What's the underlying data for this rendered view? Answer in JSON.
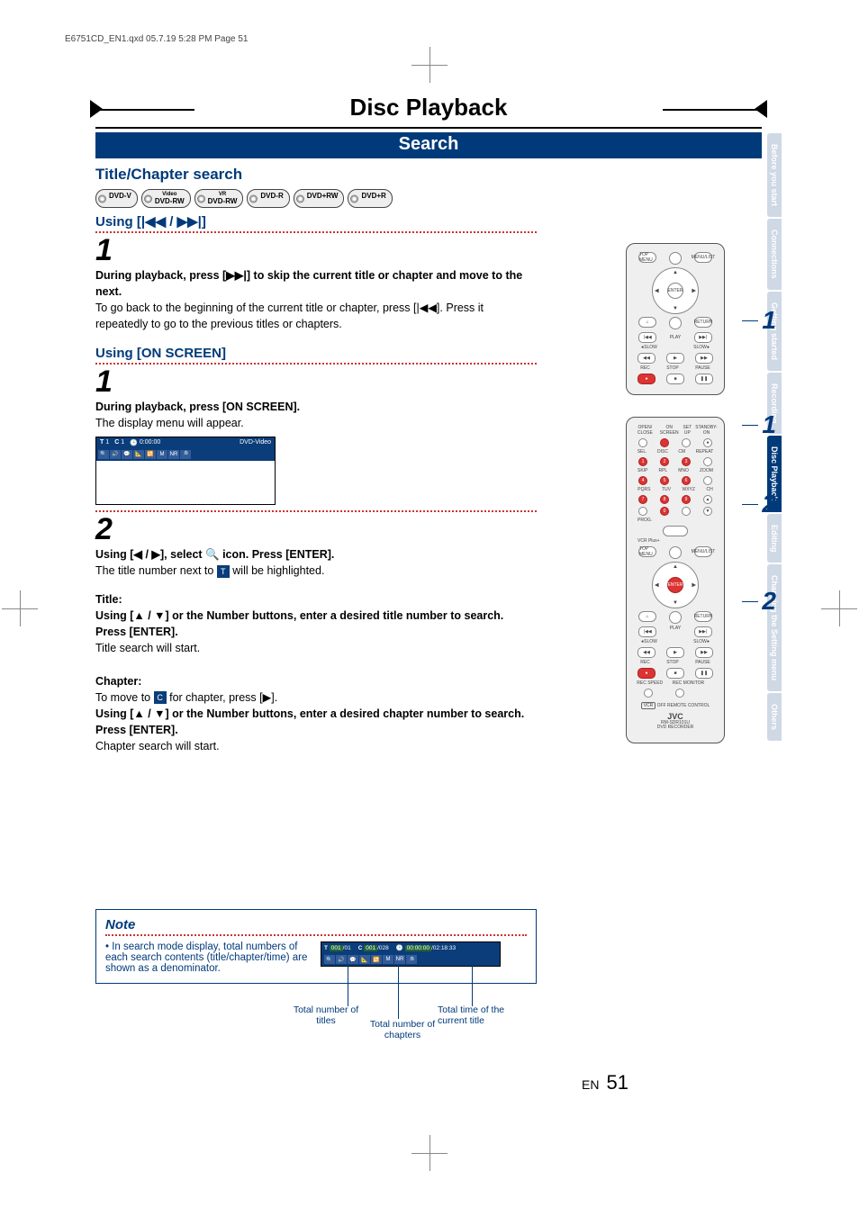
{
  "print_meta": "E6751CD_EN1.qxd  05.7.19  5:28 PM  Page 51",
  "page_title": "Disc Playback",
  "section_title": "Search",
  "h_title_chapter": "Title/Chapter search",
  "disc_badges": [
    {
      "label": "DVD-V",
      "sup": ""
    },
    {
      "label": "DVD-RW",
      "sup": "Video"
    },
    {
      "label": "DVD-RW",
      "sup": "VR"
    },
    {
      "label": "DVD-R",
      "sup": ""
    },
    {
      "label": "DVD+RW",
      "sup": ""
    },
    {
      "label": "DVD+R",
      "sup": ""
    }
  ],
  "using_skip": "Using [|◀◀ / ▶▶|]",
  "step1_a": "1",
  "skip_bold": "During playback, press [▶▶|] to skip the current title or chapter and move to the next.",
  "skip_body": "To go back to the beginning of the current title or chapter, press [|◀◀]. Press it repeatedly to go to the previous titles or chapters.",
  "using_onscreen": "Using [ON SCREEN]",
  "step1_b": "1",
  "on_bold": "During playback, press [ON SCREEN].",
  "on_body": "The display menu will appear.",
  "osd": {
    "t_label": "T",
    "t_val": "1",
    "c_label": "C",
    "c_val": "1",
    "time": "0:00:00",
    "type": "DVD-Video"
  },
  "step2": "2",
  "sel_line": "Using [◀ / ▶], select 🔍 icon. Press [ENTER].",
  "sel_body_a": "The title number next to ",
  "sel_body_b": " will be highlighted.",
  "title_hdr": "Title:",
  "title_bold": "Using [▲ / ▼] or the Number buttons, enter a desired title number to search. Press [ENTER].",
  "title_body": "Title search will start.",
  "chap_hdr": "Chapter:",
  "chap_body_a": "To move to ",
  "chap_body_b": " for chapter, press [▶].",
  "chap_bold": "Using [▲ / ▼] or the Number buttons, enter a desired chapter number to search. Press [ENTER].",
  "chap_body2": "Chapter search will start.",
  "note": {
    "title": "Note",
    "text": "• In search mode display, total numbers of each search contents (title/chapter/time) are shown as a denominator.",
    "osd": {
      "t": "T",
      "t_cur": "001",
      "t_tot": "01",
      "c": "C",
      "c_cur": "001",
      "c_tot": "028",
      "time_cur": "00:00:00",
      "time_tot": "02:18:33"
    },
    "lbl_titles": "Total number of titles",
    "lbl_chapters": "Total number of chapters",
    "lbl_time": "Total time of the current title"
  },
  "tabs": [
    "Before you start",
    "Connections",
    "Getting started",
    "Recording",
    "Disc Playback",
    "Editing",
    "Changing the Setting menu",
    "Others"
  ],
  "active_tab_index": 4,
  "remote": {
    "top_menu": "TOP MENU",
    "menu_list": "MENU/LIST",
    "enter": "ENTER",
    "return": "RETURN",
    "play": "PLAY",
    "slow": "SLOW",
    "rec": "REC",
    "stop": "STOP",
    "pause": "PAUSE",
    "open_close": "OPEN/\nCLOSE",
    "on_screen": "ON SCREEN",
    "set_up": "SET UP",
    "standby": "STANDBY-ON",
    "k1": "1",
    "k2": "2",
    "k3": "3",
    "k4": "4",
    "k5": "5",
    "k6": "6",
    "k7": "7",
    "k8": "8",
    "k9": "9",
    "k0": "0",
    "sel": "SEL.",
    "disc": "DISC",
    "cm": "CM",
    "repeat": "REPEAT",
    "skip": "SKIP",
    "rpl": "RPL",
    "mno": "MNO",
    "zoom": "ZOOM",
    "pqrs": "PQRS",
    "tuv": "TUV",
    "wxyz": "WXYZ",
    "ch": "CH",
    "prog": "PROG.",
    "vcrplus": "VCR Plus+",
    "rec_speed": "REC\nSPEED",
    "rec_monitor": "REC\nMONITOR",
    "brand": "JVC",
    "model": "RM-SDR101U",
    "product": "DVD RECORDER",
    "vcroff": "VCR",
    "off": "OFF",
    "remote_ctrl": "REMOTE CONTROL"
  },
  "callouts": {
    "c1": "1",
    "c2": "2"
  },
  "footer": {
    "en": "EN",
    "pn": "51"
  }
}
